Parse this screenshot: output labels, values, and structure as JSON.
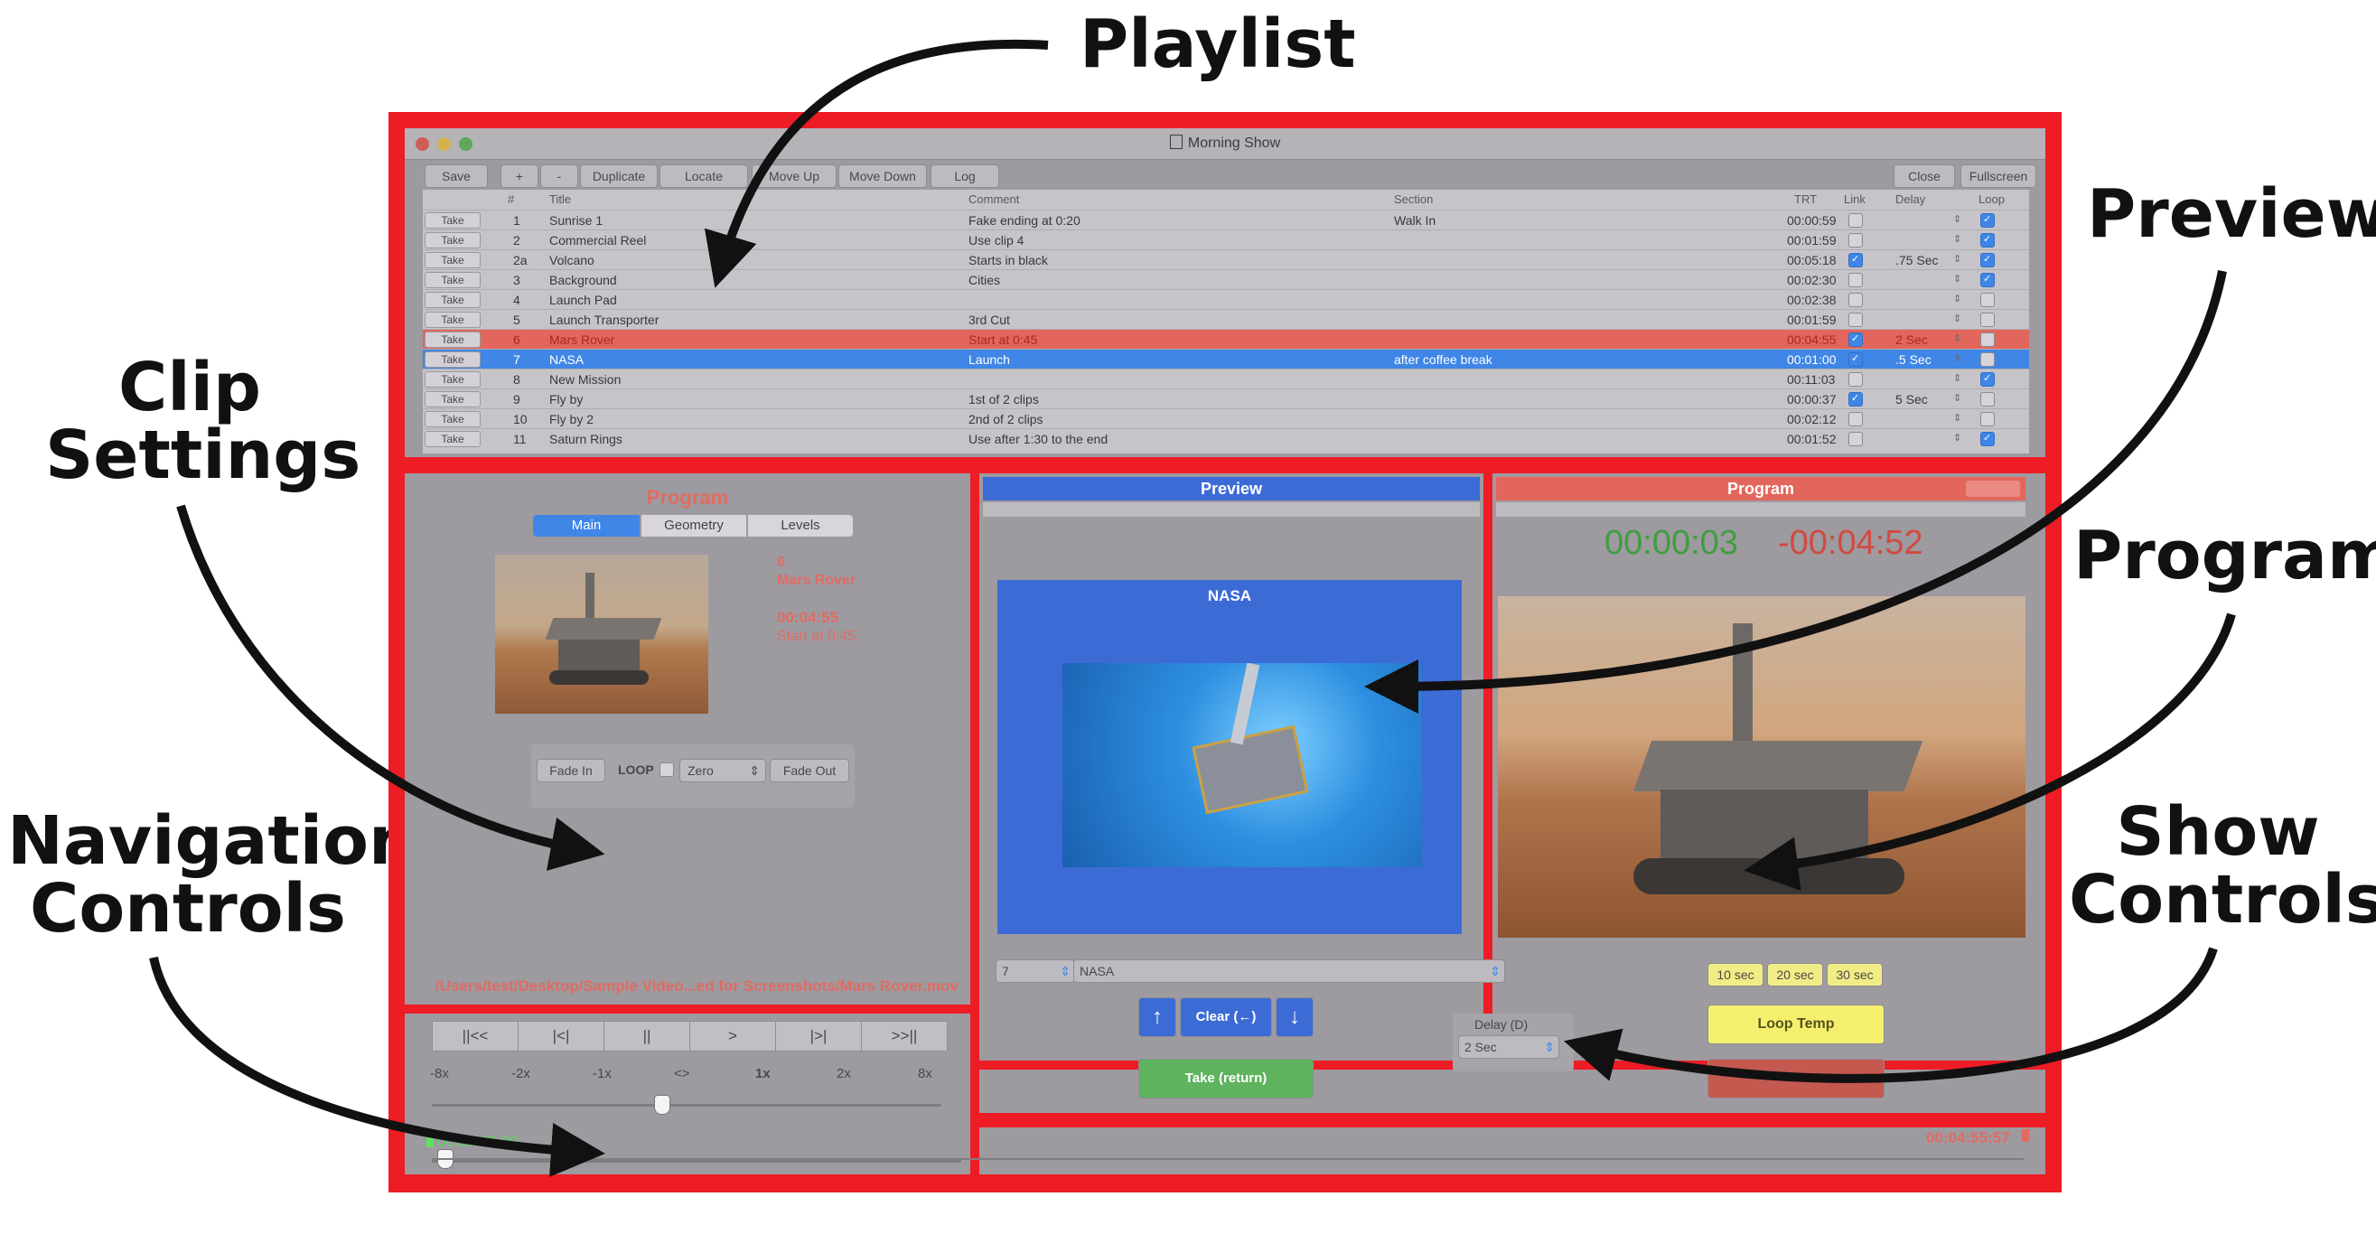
{
  "callouts": {
    "playlist": "Playlist",
    "preview": "Preview",
    "clip_settings_1": "Clip",
    "clip_settings_2": "Settings",
    "program": "Program",
    "navigation_1": "Navigation",
    "navigation_2": "Controls",
    "show_1": "Show",
    "show_2": "Controls"
  },
  "window": {
    "title": "Morning Show"
  },
  "toolbar": {
    "save": "Save",
    "plus": "+",
    "minus": "-",
    "duplicate": "Duplicate",
    "locate": "Locate",
    "move_up": "Move Up",
    "move_down": "Move Down",
    "log": "Log",
    "close": "Close",
    "fullscreen": "Fullscreen"
  },
  "playlist": {
    "columns": {
      "num": "#",
      "title": "Title",
      "comment": "Comment",
      "section": "Section",
      "trt": "TRT",
      "link": "Link",
      "delay": "Delay",
      "loop": "Loop"
    },
    "take_label": "Take",
    "rows": [
      {
        "num": "1",
        "title": "Sunrise 1",
        "comment": "Fake ending at 0:20",
        "section": "Walk In",
        "trt": "00:00:59",
        "link": false,
        "delay": "",
        "loop": true
      },
      {
        "num": "2",
        "title": "Commercial Reel",
        "comment": "Use clip 4",
        "section": "",
        "trt": "00:01:59",
        "link": false,
        "delay": "",
        "loop": true
      },
      {
        "num": "2a",
        "title": "Volcano",
        "comment": "Starts in black",
        "section": "",
        "trt": "00:05:18",
        "link": true,
        "delay": ".75 Sec",
        "loop": true
      },
      {
        "num": "3",
        "title": "Background",
        "comment": "Cities",
        "section": "",
        "trt": "00:02:30",
        "link": false,
        "delay": "",
        "loop": true
      },
      {
        "num": "4",
        "title": "Launch Pad",
        "comment": "",
        "section": "",
        "trt": "00:02:38",
        "link": false,
        "delay": "",
        "loop": false
      },
      {
        "num": "5",
        "title": "Launch Transporter",
        "comment": "3rd Cut",
        "section": "",
        "trt": "00:01:59",
        "link": false,
        "delay": "",
        "loop": false
      },
      {
        "num": "6",
        "title": "Mars Rover",
        "comment": "Start at 0:45",
        "section": "",
        "trt": "00:04:55",
        "link": true,
        "delay": "2 Sec",
        "loop": false
      },
      {
        "num": "7",
        "title": "NASA",
        "comment": "Launch",
        "section": "after coffee break",
        "trt": "00:01:00",
        "link": true,
        "delay": ".5 Sec",
        "loop": false
      },
      {
        "num": "8",
        "title": "New Mission",
        "comment": "",
        "section": "",
        "trt": "00:11:03",
        "link": false,
        "delay": "",
        "loop": true
      },
      {
        "num": "9",
        "title": "Fly by",
        "comment": "1st of 2 clips",
        "section": "",
        "trt": "00:00:37",
        "link": true,
        "delay": "5 Sec",
        "loop": false
      },
      {
        "num": "10",
        "title": "Fly by 2",
        "comment": "2nd of 2 clips",
        "section": "",
        "trt": "00:02:12",
        "link": false,
        "delay": "",
        "loop": false
      },
      {
        "num": "11",
        "title": "Saturn Rings",
        "comment": "Use after 1:30 to the end",
        "section": "",
        "trt": "00:01:52",
        "link": false,
        "delay": "",
        "loop": true
      }
    ]
  },
  "clip": {
    "header": "Program",
    "tabs": [
      "Main",
      "Geometry",
      "Levels"
    ],
    "number": "6",
    "name": "Mars Rover",
    "duration": "00:04:55",
    "comment": "Start at 0:45",
    "fade_in": "Fade In",
    "loop_label": "LOOP",
    "zero": "Zero",
    "fade_out": "Fade Out",
    "path": "/Users/test/Desktop/Sample Video...ed for Screenshots/Mars Rover.mov"
  },
  "preview": {
    "header": "Preview",
    "clip_title": "NASA"
  },
  "program": {
    "header": "Program",
    "elapsed": "00:00:03",
    "remaining": "-00:04:52"
  },
  "nav": {
    "buttons": [
      "||<<",
      "|<|",
      "||",
      ">",
      "|>|",
      ">>||"
    ],
    "speeds": [
      "-8x",
      "-2x",
      "-1x",
      "<>",
      "1x",
      "2x",
      "8x"
    ],
    "start_time": "00:00:00.00",
    "end_time": "00:04:55:57",
    "slider_position": 0.45
  },
  "show": {
    "clip_select": "7",
    "clip_name": "NASA",
    "up": "↑",
    "clear": "Clear (←)",
    "down": "↓",
    "take": "Take (return)",
    "delay_label": "Delay (D)",
    "delay_value": "2 Sec",
    "quick": [
      "10 sec",
      "20 sec",
      "30 sec"
    ],
    "loop_temp": "Loop Temp"
  },
  "colors": {
    "frame": "#ee1c25",
    "selected_row": "#3f86e6",
    "program_row": "#e3665c",
    "preview_blue": "#3d6bd6",
    "take_green": "#5fb35f",
    "loop_temp": "#f4f06e"
  }
}
